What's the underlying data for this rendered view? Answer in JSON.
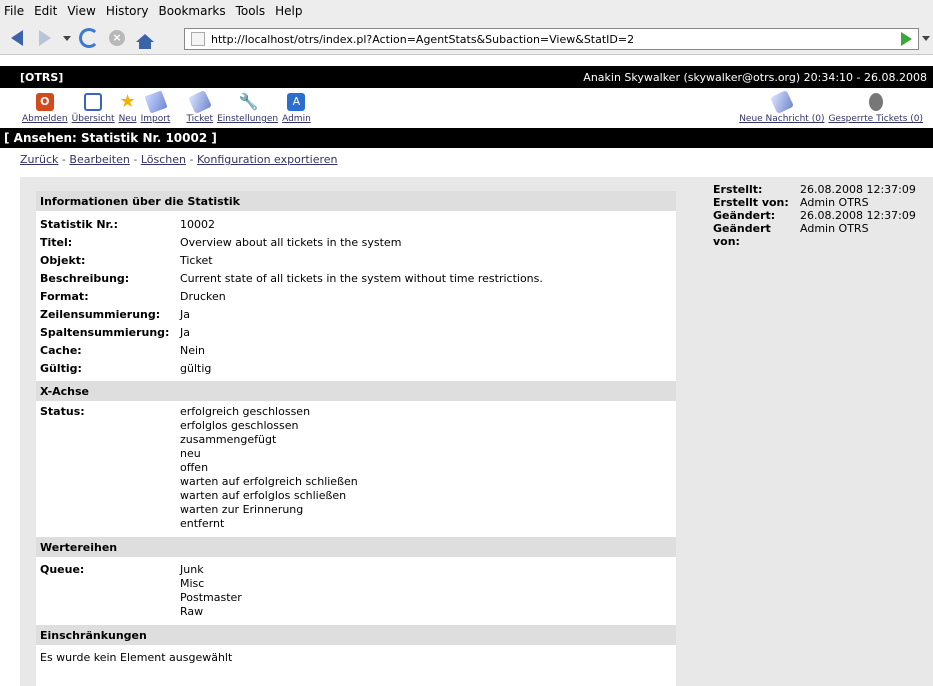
{
  "browser": {
    "menu": [
      "File",
      "Edit",
      "View",
      "History",
      "Bookmarks",
      "Tools",
      "Help"
    ],
    "url": "http://localhost/otrs/index.pl?Action=AgentStats&Subaction=View&StatID=2"
  },
  "otrs": {
    "brand": "[OTRS]",
    "user_info": "Anakin Skywalker (skywalker@otrs.org) 20:34:10 - 26.08.2008",
    "toolbar": {
      "logout": "Abmelden",
      "overview": "Übersicht",
      "new": "Neu",
      "import": "Import",
      "ticket": "Ticket",
      "settings": "Einstellungen",
      "admin": "Admin",
      "new_message": "Neue Nachricht (0)",
      "locked_tickets": "Gesperrte Tickets (0)"
    },
    "page_title": "[ Ansehen: Statistik Nr. 10002 ]",
    "actions": {
      "back": "Zurück",
      "edit": "Bearbeiten",
      "delete": "Löschen",
      "export": "Konfiguration exportieren",
      "sep": "-"
    },
    "info": {
      "header": "Informationen über die Statistik",
      "rows": [
        {
          "key": "Statistik Nr.:",
          "value": "10002"
        },
        {
          "key": "Titel:",
          "value": "Overview about all tickets in the system"
        },
        {
          "key": "Objekt:",
          "value": "Ticket"
        },
        {
          "key": "Beschreibung:",
          "value": "Current state of all tickets in the system without time restrictions."
        },
        {
          "key": "Format:",
          "value": "Drucken"
        },
        {
          "key": "Zeilensummierung:",
          "value": "Ja"
        },
        {
          "key": "Spaltensummierung:",
          "value": "Ja"
        },
        {
          "key": "Cache:",
          "value": "Nein"
        },
        {
          "key": "Gültig:",
          "value": "gültig"
        }
      ]
    },
    "xaxis": {
      "header": "X-Achse",
      "key": "Status:",
      "values": [
        "erfolgreich geschlossen",
        "erfolglos geschlossen",
        "zusammengefügt",
        "neu",
        "offen",
        "warten auf erfolgreich schließen",
        "warten auf erfolglos schließen",
        "warten zur Erinnerung",
        "entfernt"
      ]
    },
    "series": {
      "header": "Wertereihen",
      "key": "Queue:",
      "values": [
        "Junk",
        "Misc",
        "Postmaster",
        "Raw"
      ]
    },
    "restrictions": {
      "header": "Einschränkungen",
      "text": "Es wurde kein Element ausgewählt"
    },
    "meta": {
      "created_label": "Erstellt:",
      "created": "26.08.2008 12:37:09",
      "created_by_label": "Erstellt von:",
      "created_by": "Admin OTRS",
      "changed_label": "Geändert:",
      "changed": "26.08.2008 12:37:09",
      "changed_by_label": "Geändert von:",
      "changed_by": "Admin OTRS"
    }
  }
}
